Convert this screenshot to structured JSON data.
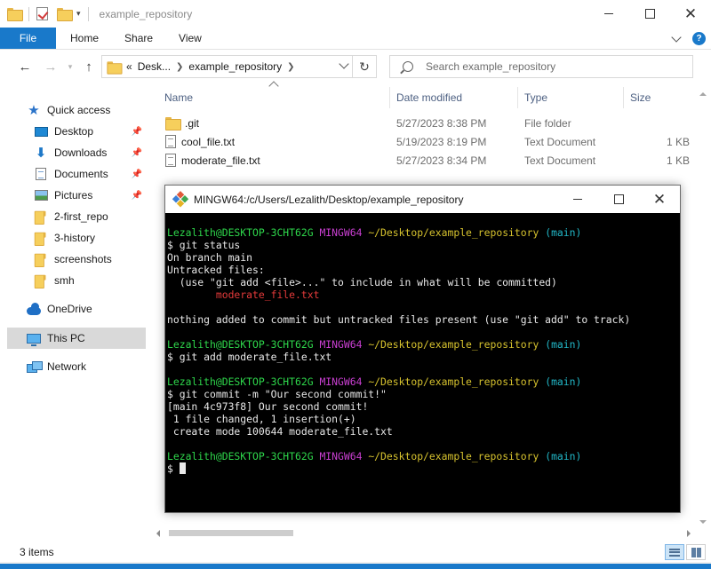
{
  "window": {
    "title": "example_repository"
  },
  "ribbon": {
    "tabs": [
      "File",
      "Home",
      "Share",
      "View"
    ],
    "help": "?"
  },
  "address": {
    "prefix": "«",
    "crumbs": [
      "Desk...",
      "example_repository"
    ],
    "refresh": "↻"
  },
  "search": {
    "placeholder": "Search example_repository"
  },
  "nav": {
    "back": "←",
    "forward": "→",
    "up": "↑",
    "items": [
      {
        "label": "Quick access",
        "icon": "star-icon",
        "pinned": false
      },
      {
        "label": "Desktop",
        "icon": "desktop-icon",
        "pinned": true
      },
      {
        "label": "Downloads",
        "icon": "download-icon",
        "pinned": true
      },
      {
        "label": "Documents",
        "icon": "documents-icon",
        "pinned": true
      },
      {
        "label": "Pictures",
        "icon": "pictures-icon",
        "pinned": true
      },
      {
        "label": "2-first_repo",
        "icon": "folder-icon",
        "pinned": false
      },
      {
        "label": "3-history",
        "icon": "folder-icon",
        "pinned": false
      },
      {
        "label": "screenshots",
        "icon": "folder-icon",
        "pinned": false
      },
      {
        "label": "smh",
        "icon": "folder-icon",
        "pinned": false
      },
      {
        "label": "OneDrive",
        "icon": "onedrive-icon",
        "pinned": false
      },
      {
        "label": "This PC",
        "icon": "this-pc-icon",
        "pinned": false
      },
      {
        "label": "Network",
        "icon": "network-icon",
        "pinned": false
      }
    ]
  },
  "columns": {
    "name": "Name",
    "date": "Date modified",
    "type": "Type",
    "size": "Size"
  },
  "files": [
    {
      "name": ".git",
      "date": "5/27/2023 8:38 PM",
      "type": "File folder",
      "size": "",
      "icon": "folder-icon"
    },
    {
      "name": "cool_file.txt",
      "date": "5/19/2023 8:19 PM",
      "type": "Text Document",
      "size": "1 KB",
      "icon": "text-file-icon"
    },
    {
      "name": "moderate_file.txt",
      "date": "5/27/2023 8:34 PM",
      "type": "Text Document",
      "size": "1 KB",
      "icon": "text-file-icon"
    }
  ],
  "status": {
    "items": "3 items"
  },
  "terminal": {
    "title": "MINGW64:/c/Users/Lezalith/Desktop/example_repository",
    "prompt_user": "Lezalith@DESKTOP-3CHT62G",
    "prompt_env": "MINGW64",
    "prompt_path": "~/Desktop/example_repository",
    "prompt_branch": "(main)",
    "blocks": [
      {
        "command": "$ git status",
        "output": [
          {
            "text": "On branch main",
            "color": "default"
          },
          {
            "text": "Untracked files:",
            "color": "default"
          },
          {
            "text": "  (use \"git add <file>...\" to include in what will be committed)",
            "color": "default"
          },
          {
            "text": "        moderate_file.txt",
            "color": "red"
          },
          {
            "text": "",
            "color": "default"
          },
          {
            "text": "nothing added to commit but untracked files present (use \"git add\" to track)",
            "color": "default"
          }
        ]
      },
      {
        "command": "$ git add moderate_file.txt",
        "output": []
      },
      {
        "command": "$ git commit -m \"Our second commit!\"",
        "output": [
          {
            "text": "[main 4c973f8] Our second commit!",
            "color": "default"
          },
          {
            "text": " 1 file changed, 1 insertion(+)",
            "color": "default"
          },
          {
            "text": " create mode 100644 moderate_file.txt",
            "color": "default"
          }
        ]
      }
    ],
    "final_prompt": "$",
    "colors": {
      "user": "#2ed64b",
      "env": "#c93fd1",
      "path": "#d6c22e",
      "branch": "#22b8c8",
      "error": "#e33a3a"
    }
  },
  "colors": {
    "accent": "#1979ca",
    "selection": "#d9d9d9"
  }
}
